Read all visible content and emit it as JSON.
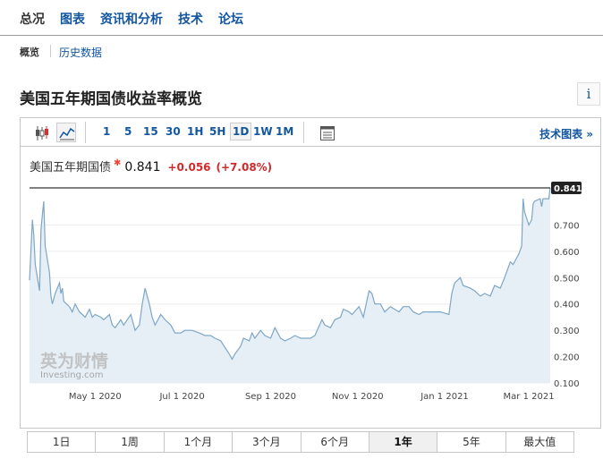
{
  "nav": {
    "items": [
      "总况",
      "图表",
      "资讯和分析",
      "技术",
      "论坛"
    ],
    "active_index": 0
  },
  "subnav": {
    "active": "概览",
    "link": "历史数据"
  },
  "page_title": "美国五年期国债收益率概览",
  "info_icon_glyph": "i",
  "toolbar": {
    "icons": [
      "candlestick-icon",
      "line-chart-icon"
    ],
    "intervals": [
      "1",
      "5",
      "15",
      "30",
      "1H",
      "5H",
      "1D",
      "1W",
      "1M"
    ],
    "selected_interval": "1D",
    "settings_icon": "table-icon",
    "technical_link": "技术图表 »"
  },
  "quote": {
    "name": "美国五年期国债",
    "last": "0.841",
    "change": "+0.056",
    "change_pct": "(+7.08%)"
  },
  "ranges": [
    "1日",
    "1周",
    "1个月",
    "3个月",
    "6个月",
    "1年",
    "5年",
    "最大值"
  ],
  "selected_range": "1年",
  "watermark": {
    "cn": "英为财情",
    "en": "Investing.com"
  },
  "colors": {
    "line": "#7ea6c6",
    "fill": "#e6eff6",
    "up": "#d02a2a",
    "link": "#1256a0"
  },
  "chart_data": {
    "type": "area",
    "x_tick_labels": [
      "May 1 2020",
      "Jul 1 2020",
      "Sep 1 2020",
      "Nov 1 2020",
      "Jan 1 2021",
      "Mar 1 2021"
    ],
    "y_tick_labels": [
      "0.700",
      "0.600",
      "0.500",
      "0.400",
      "0.300",
      "0.200",
      "0.100"
    ],
    "y_ticks": [
      0.7,
      0.6,
      0.5,
      0.4,
      0.3,
      0.2,
      0.1
    ],
    "ylim": [
      0.1,
      0.841
    ],
    "last_value_label": "0.841",
    "last_value": 0.841,
    "x_range": [
      "2020-03-16",
      "2021-03-16"
    ],
    "points": [
      [
        "2020-03-16",
        0.49
      ],
      [
        "2020-03-18",
        0.72
      ],
      [
        "2020-03-19",
        0.66
      ],
      [
        "2020-03-20",
        0.55
      ],
      [
        "2020-03-23",
        0.45
      ],
      [
        "2020-03-24",
        0.68
      ],
      [
        "2020-03-25",
        0.74
      ],
      [
        "2020-03-26",
        0.79
      ],
      [
        "2020-03-27",
        0.62
      ],
      [
        "2020-03-30",
        0.52
      ],
      [
        "2020-03-31",
        0.43
      ],
      [
        "2020-04-01",
        0.4
      ],
      [
        "2020-04-03",
        0.44
      ],
      [
        "2020-04-06",
        0.48
      ],
      [
        "2020-04-07",
        0.44
      ],
      [
        "2020-04-08",
        0.46
      ],
      [
        "2020-04-09",
        0.41
      ],
      [
        "2020-04-13",
        0.39
      ],
      [
        "2020-04-15",
        0.37
      ],
      [
        "2020-04-17",
        0.4
      ],
      [
        "2020-04-20",
        0.37
      ],
      [
        "2020-04-22",
        0.36
      ],
      [
        "2020-04-24",
        0.35
      ],
      [
        "2020-04-27",
        0.38
      ],
      [
        "2020-04-29",
        0.35
      ],
      [
        "2020-05-01",
        0.36
      ],
      [
        "2020-05-05",
        0.35
      ],
      [
        "2020-05-07",
        0.34
      ],
      [
        "2020-05-11",
        0.36
      ],
      [
        "2020-05-13",
        0.32
      ],
      [
        "2020-05-15",
        0.31
      ],
      [
        "2020-05-19",
        0.34
      ],
      [
        "2020-05-21",
        0.32
      ],
      [
        "2020-05-26",
        0.36
      ],
      [
        "2020-05-29",
        0.3
      ],
      [
        "2020-06-01",
        0.32
      ],
      [
        "2020-06-03",
        0.4
      ],
      [
        "2020-06-05",
        0.46
      ],
      [
        "2020-06-08",
        0.4
      ],
      [
        "2020-06-10",
        0.35
      ],
      [
        "2020-06-12",
        0.32
      ],
      [
        "2020-06-16",
        0.36
      ],
      [
        "2020-06-19",
        0.34
      ],
      [
        "2020-06-23",
        0.32
      ],
      [
        "2020-06-26",
        0.29
      ],
      [
        "2020-06-30",
        0.29
      ],
      [
        "2020-07-03",
        0.3
      ],
      [
        "2020-07-08",
        0.3
      ],
      [
        "2020-07-13",
        0.29
      ],
      [
        "2020-07-17",
        0.28
      ],
      [
        "2020-07-21",
        0.28
      ],
      [
        "2020-07-24",
        0.27
      ],
      [
        "2020-07-28",
        0.26
      ],
      [
        "2020-08-03",
        0.21
      ],
      [
        "2020-08-05",
        0.19
      ],
      [
        "2020-08-07",
        0.21
      ],
      [
        "2020-08-11",
        0.24
      ],
      [
        "2020-08-13",
        0.27
      ],
      [
        "2020-08-17",
        0.26
      ],
      [
        "2020-08-19",
        0.29
      ],
      [
        "2020-08-21",
        0.27
      ],
      [
        "2020-08-25",
        0.3
      ],
      [
        "2020-08-28",
        0.28
      ],
      [
        "2020-09-01",
        0.27
      ],
      [
        "2020-09-04",
        0.31
      ],
      [
        "2020-09-08",
        0.27
      ],
      [
        "2020-09-11",
        0.26
      ],
      [
        "2020-09-15",
        0.27
      ],
      [
        "2020-09-18",
        0.28
      ],
      [
        "2020-09-22",
        0.27
      ],
      [
        "2020-09-25",
        0.27
      ],
      [
        "2020-09-29",
        0.27
      ],
      [
        "2020-10-02",
        0.28
      ],
      [
        "2020-10-07",
        0.34
      ],
      [
        "2020-10-09",
        0.32
      ],
      [
        "2020-10-13",
        0.31
      ],
      [
        "2020-10-16",
        0.34
      ],
      [
        "2020-10-20",
        0.35
      ],
      [
        "2020-10-22",
        0.38
      ],
      [
        "2020-10-26",
        0.37
      ],
      [
        "2020-10-28",
        0.36
      ],
      [
        "2020-11-02",
        0.39
      ],
      [
        "2020-11-05",
        0.35
      ],
      [
        "2020-11-09",
        0.45
      ],
      [
        "2020-11-11",
        0.44
      ],
      [
        "2020-11-13",
        0.4
      ],
      [
        "2020-11-17",
        0.4
      ],
      [
        "2020-11-20",
        0.37
      ],
      [
        "2020-11-24",
        0.39
      ],
      [
        "2020-11-30",
        0.37
      ],
      [
        "2020-12-03",
        0.39
      ],
      [
        "2020-12-07",
        0.39
      ],
      [
        "2020-12-10",
        0.37
      ],
      [
        "2020-12-14",
        0.36
      ],
      [
        "2020-12-17",
        0.37
      ],
      [
        "2020-12-21",
        0.37
      ],
      [
        "2020-12-24",
        0.37
      ],
      [
        "2020-12-29",
        0.37
      ],
      [
        "2021-01-04",
        0.36
      ],
      [
        "2021-01-06",
        0.44
      ],
      [
        "2021-01-08",
        0.48
      ],
      [
        "2021-01-12",
        0.5
      ],
      [
        "2021-01-14",
        0.47
      ],
      [
        "2021-01-19",
        0.46
      ],
      [
        "2021-01-22",
        0.45
      ],
      [
        "2021-01-26",
        0.43
      ],
      [
        "2021-01-29",
        0.44
      ],
      [
        "2021-02-02",
        0.43
      ],
      [
        "2021-02-05",
        0.47
      ],
      [
        "2021-02-09",
        0.46
      ],
      [
        "2021-02-12",
        0.5
      ],
      [
        "2021-02-16",
        0.56
      ],
      [
        "2021-02-18",
        0.55
      ],
      [
        "2021-02-22",
        0.59
      ],
      [
        "2021-02-24",
        0.62
      ],
      [
        "2021-02-25",
        0.8
      ],
      [
        "2021-02-26",
        0.75
      ],
      [
        "2021-03-01",
        0.7
      ],
      [
        "2021-03-03",
        0.72
      ],
      [
        "2021-03-04",
        0.78
      ],
      [
        "2021-03-05",
        0.79
      ],
      [
        "2021-03-09",
        0.8
      ],
      [
        "2021-03-10",
        0.77
      ],
      [
        "2021-03-11",
        0.8
      ],
      [
        "2021-03-15",
        0.8
      ],
      [
        "2021-03-16",
        0.841
      ]
    ]
  }
}
